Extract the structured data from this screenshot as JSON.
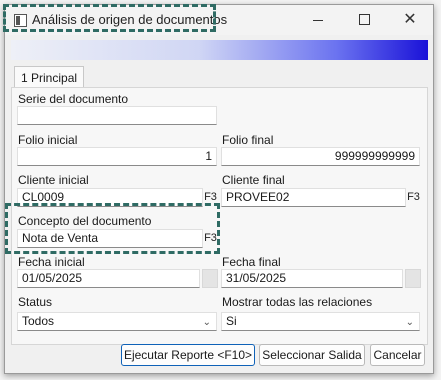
{
  "window": {
    "title": "Análisis de origen de documentos",
    "close_glyph": "✕"
  },
  "tabs": [
    {
      "label": "1 Principal"
    }
  ],
  "form": {
    "serie": {
      "label": "Serie del documento",
      "value": ""
    },
    "folio_inicial": {
      "label": "Folio inicial",
      "value": "1"
    },
    "folio_final": {
      "label": "Folio final",
      "value": "999999999999"
    },
    "cliente_inicial": {
      "label": "Cliente inicial",
      "value": "CL0009",
      "key": "F3"
    },
    "cliente_final": {
      "label": "Cliente final",
      "value": "PROVEE02",
      "key": "F3"
    },
    "concepto": {
      "label": "Concepto del documento",
      "value": "Nota de Venta",
      "key": "F3"
    },
    "fecha_inicial": {
      "label": "Fecha inicial",
      "value": "01/05/2025"
    },
    "fecha_final": {
      "label": "Fecha final",
      "value": "31/05/2025"
    },
    "status": {
      "label": "Status",
      "value": "Todos"
    },
    "relaciones": {
      "label": "Mostrar todas las relaciones",
      "value": "Si"
    }
  },
  "buttons": {
    "ejecutar": "Ejecutar Reporte <F10>",
    "seleccionar": "Seleccionar Salida",
    "cancelar": "Cancelar"
  },
  "colors": {
    "highlight": "#2f6b64",
    "gradient_end": "#1a12d8",
    "primary_border": "#0f62b8"
  },
  "icons": [
    "app-icon",
    "minimize-icon",
    "maximize-icon",
    "close-icon",
    "chevron-down-icon"
  ]
}
